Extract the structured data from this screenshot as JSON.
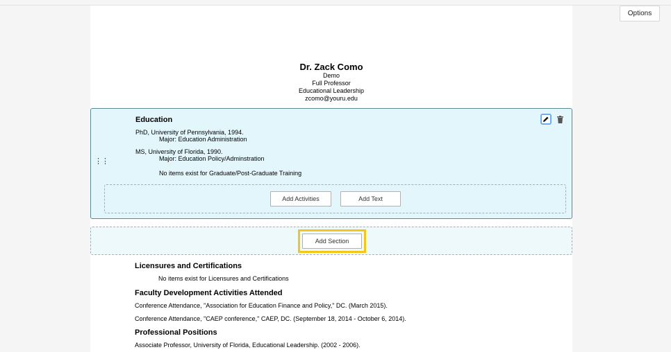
{
  "toolbar": {
    "options_label": "Options"
  },
  "header": {
    "name": "Dr. Zack Como",
    "line1": "Demo",
    "line2": "Full Professor",
    "line3": "Educational Leadership",
    "email": "zcomo@youru.edu"
  },
  "education": {
    "title": "Education",
    "degree1": "PhD, University of Pennsylvania, 1994.",
    "major1": "Major: Education Administration",
    "degree2": "MS, University of Florida, 1990.",
    "major2": "Major: Education Policy/Adminstration",
    "empty_note": "No items exist for Graduate/Post-Graduate Training",
    "add_activities_label": "Add Activities",
    "add_text_label": "Add Text"
  },
  "add_section_label": "Add Section",
  "licensures": {
    "title": "Licensures and Certifications",
    "empty_note": "No items exist for Licensures and Certifications"
  },
  "faculty_dev": {
    "title": "Faculty Development Activities Attended",
    "items": [
      "Conference Attendance, \"Association for Education Finance and Policy,\" DC. (March 2015).",
      "Conference Attendance, \"CAEP conference,\" CAEP, DC. (September 18, 2014 - October 6, 2014)."
    ]
  },
  "positions": {
    "title": "Professional Positions",
    "items": [
      "Associate Professor, University of Florida, Educational Leadership. (2002 - 2006)."
    ]
  }
}
